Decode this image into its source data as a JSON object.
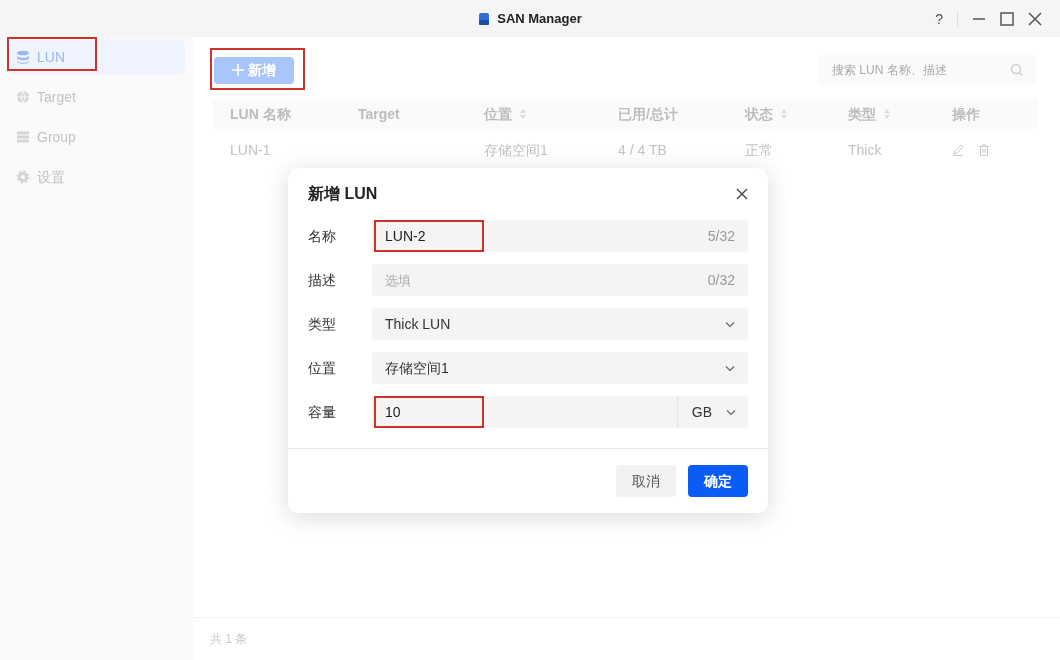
{
  "window": {
    "title": "SAN Manager",
    "help": "?"
  },
  "sidebar": {
    "items": [
      {
        "label": "LUN",
        "selected": true,
        "highlighted": true
      },
      {
        "label": "Target",
        "selected": false,
        "highlighted": false
      },
      {
        "label": "Group",
        "selected": false,
        "highlighted": false
      },
      {
        "label": "设置",
        "selected": false,
        "highlighted": false
      }
    ]
  },
  "toolbar": {
    "add_button": {
      "label": "新增",
      "highlighted": true
    },
    "search": {
      "placeholder": "搜索 LUN 名称、描述"
    }
  },
  "table": {
    "columns": [
      {
        "label": "LUN 名称",
        "sortable": false
      },
      {
        "label": "Target",
        "sortable": false
      },
      {
        "label": "位置",
        "sortable": true
      },
      {
        "label": "已用/总计",
        "sortable": false
      },
      {
        "label": "状态",
        "sortable": true
      },
      {
        "label": "类型",
        "sortable": true
      },
      {
        "label": "操作",
        "sortable": false
      }
    ],
    "rows": [
      {
        "name": "LUN-1",
        "position": "存储空间1",
        "used_total": "4 / 4 TB",
        "status": "正常",
        "type": "Thick"
      }
    ]
  },
  "footer": {
    "total": "共 1 条"
  },
  "dialog": {
    "title": "新增 LUN",
    "fields": [
      {
        "kind": "text",
        "label": "名称",
        "value": "LUN-2",
        "counter": "5/32",
        "highlighted": true
      },
      {
        "kind": "text",
        "label": "描述",
        "placeholder": "选填",
        "counter": "0/32",
        "highlighted": false
      },
      {
        "kind": "select",
        "label": "类型",
        "value": "Thick LUN",
        "highlighted": false
      },
      {
        "kind": "select",
        "label": "位置",
        "value": "存储空间1",
        "highlighted": false
      },
      {
        "kind": "unit",
        "label": "容量",
        "value": "10",
        "unit": "GB",
        "highlighted": true
      }
    ],
    "buttons": [
      {
        "label": "取消",
        "primary": false
      },
      {
        "label": "确定",
        "primary": true
      }
    ]
  }
}
